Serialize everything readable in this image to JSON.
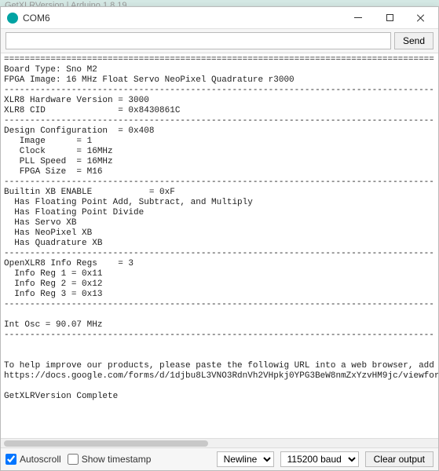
{
  "background_tab": "GetXLRVersion | Arduino 1.8.19",
  "window": {
    "title": "COM6"
  },
  "input": {
    "value": "",
    "placeholder": ""
  },
  "send_button": "Send",
  "output_text": "===================================================================================\nBoard Type: Sno M2\nFPGA Image: 16 MHz Float Servo NeoPixel Quadrature r3000\n-----------------------------------------------------------------------------------\nXLR8 Hardware Version = 3000\nXLR8 CID              = 0x8430861C\n-----------------------------------------------------------------------------------\nDesign Configuration  = 0x408\n   Image      = 1\n   Clock      = 16MHz\n   PLL Speed  = 16MHz\n   FPGA Size  = M16\n-----------------------------------------------------------------------------------\nBuiltin XB ENABLE           = 0xF\n  Has Floating Point Add, Subtract, and Multiply\n  Has Floating Point Divide\n  Has Servo XB\n  Has NeoPixel XB\n  Has Quadrature XB\n-----------------------------------------------------------------------------------\nOpenXLR8 Info Regs    = 3\n  Info Reg 1 = 0x11\n  Info Reg 2 = 0x12\n  Info Reg 3 = 0x13\n-----------------------------------------------------------------------------------\n\nInt Osc = 90.07 MHz\n-----------------------------------------------------------------------------------\n\n\nTo help improve our products, please paste the followig URL into a web browser, add any no\nhttps://docs.google.com/forms/d/1djbu8L3VNO3RdnVh2VHpkj0YPG3BeW8nmZxYzvHM9jc/viewform?&ent\n\nGetXLRVersion Complete\n\n",
  "bottom": {
    "autoscroll_label": "Autoscroll",
    "autoscroll_checked": true,
    "show_timestamp_label": "Show timestamp",
    "show_timestamp_checked": false,
    "line_ending_selected": "Newline",
    "baud_selected": "115200 baud",
    "clear_button": "Clear output"
  }
}
